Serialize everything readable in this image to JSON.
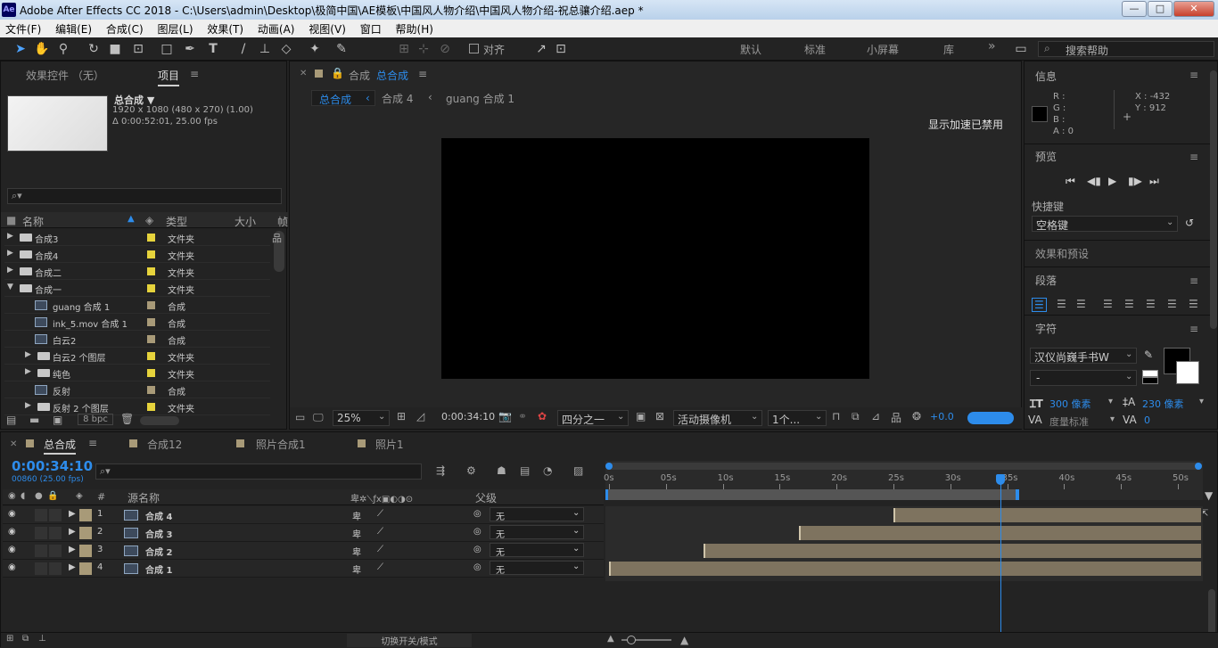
{
  "window": {
    "title": "Adobe After Effects CC 2018 - C:\\Users\\admin\\Desktop\\极简中国\\AE模板\\中国风人物介绍\\中国风人物介绍-祝总骧介绍.aep *",
    "logo": "Ae",
    "min": "—",
    "max": "□",
    "close": "✕"
  },
  "menu": [
    "文件(F)",
    "编辑(E)",
    "合成(C)",
    "图层(L)",
    "效果(T)",
    "动画(A)",
    "视图(V)",
    "窗口",
    "帮助(H)"
  ],
  "toolbar": {
    "align_label": "对齐",
    "workspaces": [
      "默认",
      "标准",
      "小屏幕",
      "库"
    ],
    "more": "»",
    "search_placeholder": "搜索帮助"
  },
  "project_panel": {
    "tab_effects": "效果控件 （无）",
    "tab_project": "项目",
    "comp_name": "总合成 ▼",
    "comp_info1": "1920 x 1080  (480 x 270) (1.00)",
    "comp_info2": "Δ 0:00:52:01, 25.00 fps",
    "search_icon": "⌕▾",
    "col_name": "名称",
    "col_type": "类型",
    "col_size": "大小",
    "col_frame": "帧",
    "items": [
      {
        "name": "合成3",
        "type": "文件夹",
        "kind": "folder",
        "indent": 0,
        "tri": "▶",
        "color": "#e6d33c"
      },
      {
        "name": "合成4",
        "type": "文件夹",
        "kind": "folder",
        "indent": 0,
        "tri": "▶",
        "color": "#e6d33c"
      },
      {
        "name": "合成二",
        "type": "文件夹",
        "kind": "folder",
        "indent": 0,
        "tri": "▶",
        "color": "#e6d33c"
      },
      {
        "name": "合成一",
        "type": "文件夹",
        "kind": "folder",
        "indent": 0,
        "tri": "▼",
        "color": "#e6d33c"
      },
      {
        "name": "guang 合成 1",
        "type": "合成",
        "kind": "comp",
        "indent": 1,
        "tri": "",
        "color": "#a89a78"
      },
      {
        "name": "ink_5.mov 合成 1",
        "type": "合成",
        "kind": "comp",
        "indent": 1,
        "tri": "",
        "color": "#a89a78"
      },
      {
        "name": "白云2",
        "type": "合成",
        "kind": "comp",
        "indent": 1,
        "tri": "",
        "color": "#a89a78"
      },
      {
        "name": "白云2 个图层",
        "type": "文件夹",
        "kind": "folder",
        "indent": 1,
        "tri": "▶",
        "color": "#e6d33c"
      },
      {
        "name": "纯色",
        "type": "文件夹",
        "kind": "folder",
        "indent": 1,
        "tri": "▶",
        "color": "#e6d33c"
      },
      {
        "name": "反射",
        "type": "合成",
        "kind": "comp",
        "indent": 1,
        "tri": "",
        "color": "#a89a78"
      },
      {
        "name": "反射 2 个图层",
        "type": "文件夹",
        "kind": "folder",
        "indent": 1,
        "tri": "▶",
        "color": "#e6d33c"
      }
    ],
    "bpc": "8 bpc"
  },
  "comp_panel": {
    "tab_prefix": "合成",
    "tab_name": "总合成",
    "breadcrumbs": [
      "总合成",
      "合成 4",
      "guang 合成 1"
    ],
    "gpu_notice": "显示加速已禁用",
    "zoom": "25%",
    "timecode": "0:00:34:10",
    "resolution": "四分之一",
    "camera": "活动摄像机",
    "views": "1个...",
    "exposure": "+0.0"
  },
  "right_panel": {
    "info_title": "信息",
    "r": "R :",
    "g": "G :",
    "b": "B :",
    "a": "A : 0",
    "x": "X : -432",
    "y": "Y : 912",
    "preview_title": "预览",
    "shortcut_label": "快捷键",
    "shortcut_value": "空格键",
    "effects_title": "效果和预设",
    "paragraph_title": "段落",
    "character_title": "字符",
    "font_name": "汉仪尚巍手书W",
    "font_style": "-",
    "font_size": "300 像素",
    "leading": "230 像素",
    "tracking_label": "度量标准",
    "tracking_value": "0"
  },
  "timeline": {
    "tabs": [
      "总合成",
      "合成12",
      "照片合成1",
      "照片1"
    ],
    "timecode": "0:00:34:10",
    "frame_info": "00860 (25.00 fps)",
    "search_placeholder": "⌕▾",
    "col_source": "源名称",
    "col_parent": "父级",
    "col_hash": "#",
    "ruler": [
      "0s",
      "05s",
      "10s",
      "15s",
      "20s",
      "25s",
      "30s",
      "35s",
      "40s",
      "45s",
      "50s"
    ],
    "layers": [
      {
        "num": "1",
        "name": "合成 4",
        "parent": "无",
        "start_sec": 25.0
      },
      {
        "num": "2",
        "name": "合成 3",
        "parent": "无",
        "start_sec": 16.7
      },
      {
        "num": "3",
        "name": "合成 2",
        "parent": "无",
        "start_sec": 8.3
      },
      {
        "num": "4",
        "name": "合成 1",
        "parent": "无",
        "start_sec": 0.0
      }
    ],
    "duration_sec": 52.04,
    "playhead_sec": 34.4,
    "work_area_end_sec": 35.9,
    "footer_label": "切换开关/模式"
  },
  "colors": {
    "accent": "#2d8ceb",
    "layer_bar": "#7e735f",
    "folder_label": "#e6d33c",
    "comp_label": "#a89a78"
  }
}
